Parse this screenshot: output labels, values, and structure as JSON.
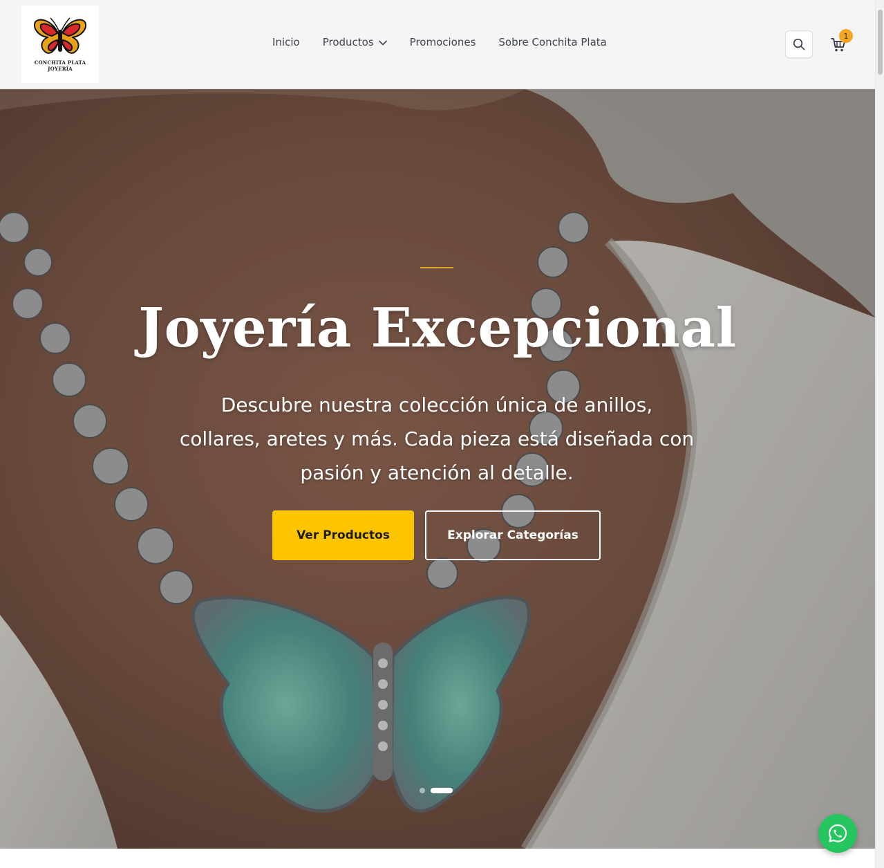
{
  "header": {
    "logo": {
      "line1": "CONCHITA PLATA",
      "line2": "JOYERÍA",
      "icon": "butterfly-logo"
    },
    "nav": [
      {
        "label": "Inicio"
      },
      {
        "label": "Productos",
        "icon": "chevron-down-icon"
      },
      {
        "label": "Promociones"
      },
      {
        "label": "Sobre Conchita Plata"
      }
    ],
    "search_icon": "search-icon",
    "cart": {
      "icon": "cart-icon",
      "count": "1"
    }
  },
  "hero": {
    "title": "Joyería Excepcional",
    "subtitle": "Descubre nuestra colección única de anillos, collares, aretes y más. Cada pieza está diseñada con pasión y atención al detalle.",
    "primary_button": "Ver Productos",
    "secondary_button": "Explorar Categorías",
    "slides_total": 2,
    "active_slide": 2
  },
  "floating": {
    "whatsapp_icon": "whatsapp-icon"
  },
  "colors": {
    "accent": "#fcc500",
    "accent_line": "#e0a820",
    "cart_badge": "#f5a623",
    "whatsapp": "#25c560",
    "header_bg": "#f6f5f5"
  }
}
